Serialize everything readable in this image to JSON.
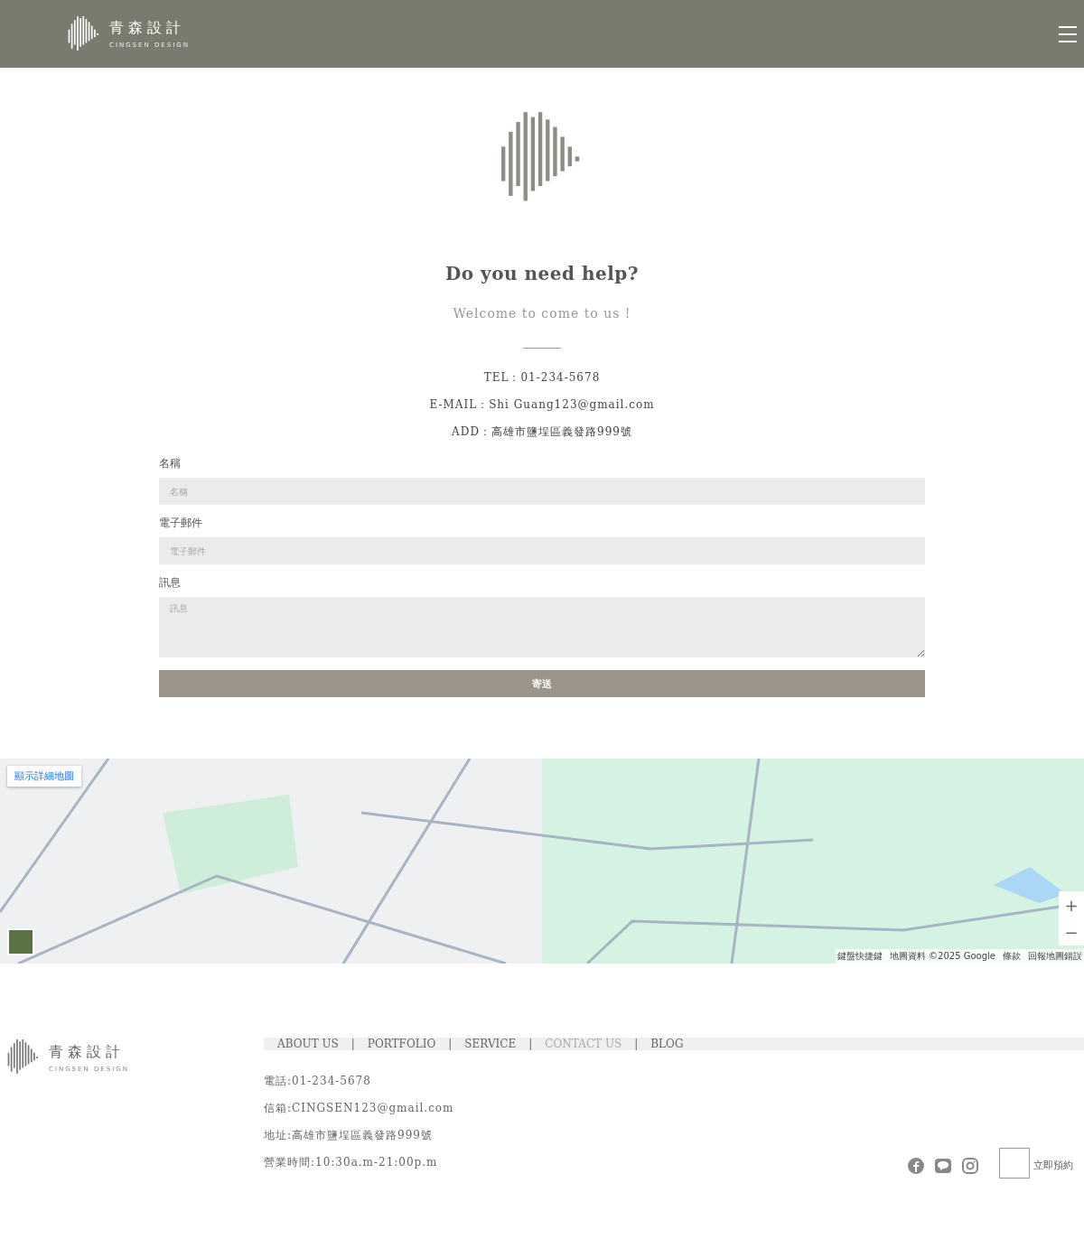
{
  "header": {
    "brand": "青森設計",
    "brand_sub": "CINGSEN DESIGN"
  },
  "contact": {
    "title": "Do you need help?",
    "subtitle": "Welcome to come to us !",
    "lines": [
      "TEL：01-234-5678",
      "E-MAIL：Shi Guang123@gmail.com",
      "ADD：高雄市鹽埕區義發路999號"
    ]
  },
  "form": {
    "fields": [
      {
        "kind": "input",
        "label": "名稱",
        "placeholder": "名稱"
      },
      {
        "kind": "input",
        "label": "電子郵件",
        "placeholder": "電子郵件"
      },
      {
        "kind": "textarea",
        "label": "訊息",
        "placeholder": "訊息"
      }
    ],
    "submit": "寄送"
  },
  "map": {
    "detail_link": "顯示詳細地圖",
    "zoom_in": "+",
    "zoom_out": "−",
    "attribution": [
      "鍵盤快捷鍵",
      "地圖資料 ©2025 Google",
      "條款",
      "回報地圖錯誤"
    ]
  },
  "footer": {
    "brand": "青森設計",
    "brand_sub": "CINGSEN DESIGN",
    "nav": [
      {
        "kind": "link",
        "label": "ABOUT US",
        "selected": false
      },
      {
        "kind": "separator",
        "label": "|"
      },
      {
        "kind": "link",
        "label": "PORTFOLIO",
        "selected": false
      },
      {
        "kind": "separator",
        "label": "|"
      },
      {
        "kind": "link",
        "label": "SERVICE",
        "selected": false
      },
      {
        "kind": "separator",
        "label": "|"
      },
      {
        "kind": "link",
        "label": "CONTACT US",
        "selected": true
      },
      {
        "kind": "separator",
        "label": "|"
      },
      {
        "kind": "link",
        "label": "BLOG",
        "selected": false
      }
    ],
    "info": [
      "電話:01-234-5678",
      "信箱:CINGSEN123@gmail.com",
      "地址:高雄市鹽埕區義發路999號",
      "營業時間:10:30a.m-21:00p.m"
    ],
    "book": "立即預約"
  }
}
